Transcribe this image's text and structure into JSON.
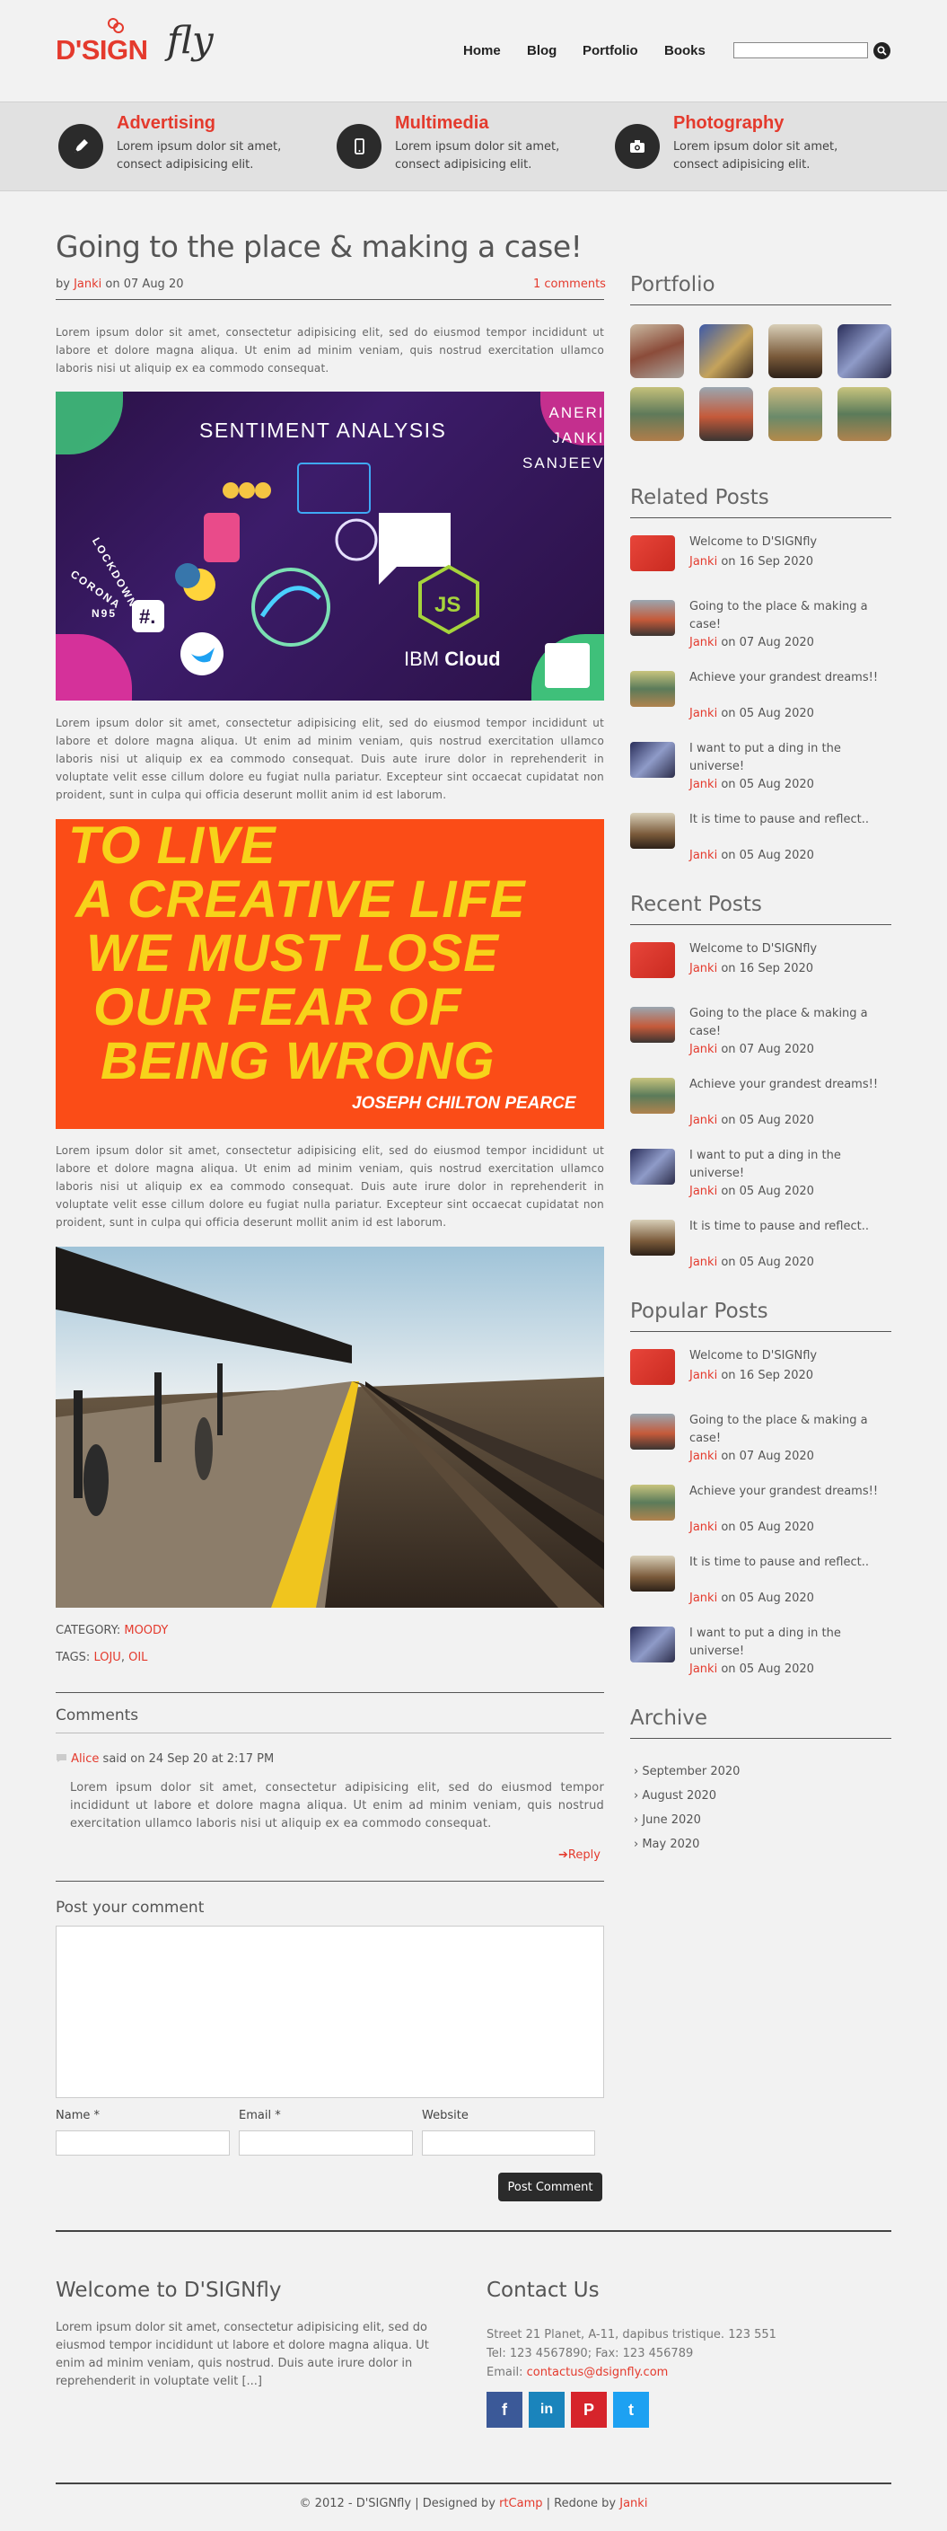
{
  "header": {
    "logo_text_main": "D'SIGN",
    "logo_text_script": "fly",
    "nav": [
      "Home",
      "Blog",
      "Portfolio",
      "Books"
    ],
    "search_placeholder": ""
  },
  "features": [
    {
      "icon": "pen-icon",
      "title": "Advertising",
      "text": "Lorem ipsum dolor sit amet, consect adipisicing elit."
    },
    {
      "icon": "phone-icon",
      "title": "Multimedia",
      "text": "Lorem ipsum dolor sit amet, consect adipisicing elit."
    },
    {
      "icon": "camera-icon",
      "title": "Photography",
      "text": "Lorem ipsum dolor sit amet, consect adipisicing elit."
    }
  ],
  "post": {
    "title": "Going to the place & making a case!",
    "by": "by",
    "author": "Janki",
    "on": "on 07 Aug 20",
    "comments_link": "1 comments",
    "para1": "Lorem ipsum dolor sit amet, consectetur adipisicing elit, sed do eiusmod tempor incididunt ut labore et dolore magna aliqua. Ut enim ad minim veniam, quis nostrud exercitation ullamco laboris nisi ut aliquip ex ea commodo consequat.",
    "para2": "Lorem ipsum dolor sit amet, consectetur adipisicing elit, sed do eiusmod tempor incididunt ut labore et dolore magna aliqua. Ut enim ad minim veniam, quis nostrud exercitation ullamco laboris nisi ut aliquip ex ea commodo consequat. Duis aute irure dolor in reprehenderit in voluptate velit esse cillum dolore eu fugiat nulla pariatur. Excepteur sint occaecat cupidatat non proident, sunt in culpa qui officia deserunt mollit anim id est laborum.",
    "para3": "Lorem ipsum dolor sit amet, consectetur adipisicing elit, sed do eiusmod tempor incididunt ut labore et dolore magna aliqua. Ut enim ad minim veniam, quis nostrud exercitation ullamco laboris nisi ut aliquip ex ea commodo consequat. Duis aute irure dolor in reprehenderit in voluptate velit esse cillum dolore eu fugiat nulla pariatur. Excepteur sint occaecat cupidatat non proident, sunt in culpa qui officia deserunt mollit anim id est laborum.",
    "img1": {
      "title": "SENTIMENT ANALYSIS",
      "names": [
        "ANERI",
        "JANKI",
        "SANJEEV"
      ],
      "side_words": [
        "LOCKDOWN",
        "CORONA",
        "N95"
      ],
      "ibm": "IBM",
      "cloud": "Cloud"
    },
    "img2": {
      "lines": [
        "TO LIVE",
        "A CREATIVE LIFE",
        "WE MUST LOSE",
        "OUR FEAR OF",
        "BEING WRONG"
      ],
      "author": "JOSEPH CHILTON PEARCE"
    },
    "category_label": "CATEGORY:",
    "category": "MOODY",
    "tags_label": "TAGS:",
    "tags": [
      "LOJU",
      "OIL"
    ]
  },
  "comments": {
    "heading": "Comments",
    "items": [
      {
        "author": "Alice",
        "said": "said on 24 Sep 20 at 2:17 PM",
        "text": "Lorem ipsum dolor sit amet, consectetur adipisicing elit, sed do eiusmod tempor incididunt ut labore et dolore magna aliqua. Ut enim ad minim veniam, quis nostrud exercitation ullamco laboris nisi ut aliquip ex ea commodo consequat.",
        "reply": "Reply"
      }
    ],
    "post_heading": "Post your comment",
    "name_label": "Name *",
    "email_label": "Email *",
    "website_label": "Website",
    "submit": "Post Comment"
  },
  "sidebar": {
    "portfolio_heading": "Portfolio",
    "related_heading": "Related Posts",
    "recent_heading": "Recent Posts",
    "popular_heading": "Popular Posts",
    "archive_heading": "Archive",
    "related": [
      {
        "title": "Welcome to D'SIGNfly",
        "author": "Janki",
        "date": "on 16 Sep 2020",
        "thumb": "red"
      },
      {
        "title": "Going to the place & making a case!",
        "author": "Janki",
        "date": "on 07 Aug 2020",
        "thumb": "city"
      },
      {
        "title": "Achieve your grandest dreams!!",
        "author": "Janki",
        "date": "on 05 Aug 2020",
        "thumb": "green"
      },
      {
        "title": "I want to put a ding in the universe!",
        "author": "Janki",
        "date": "on 05 Aug 2020",
        "thumb": "blue"
      },
      {
        "title": "It is time to pause and reflect..",
        "author": "Janki",
        "date": "on 05 Aug 2020",
        "thumb": "warm"
      }
    ],
    "recent": [
      {
        "title": "Welcome to D'SIGNfly",
        "author": "Janki",
        "date": "on 16 Sep 2020",
        "thumb": "red"
      },
      {
        "title": "Going to the place & making a case!",
        "author": "Janki",
        "date": "on 07 Aug 2020",
        "thumb": "city"
      },
      {
        "title": "Achieve your grandest dreams!!",
        "author": "Janki",
        "date": "on 05 Aug 2020",
        "thumb": "green"
      },
      {
        "title": "I want to put a ding in the universe!",
        "author": "Janki",
        "date": "on 05 Aug 2020",
        "thumb": "blue"
      },
      {
        "title": "It is time to pause and reflect..",
        "author": "Janki",
        "date": "on 05 Aug 2020",
        "thumb": "warm"
      }
    ],
    "popular": [
      {
        "title": "Welcome to D'SIGNfly",
        "author": "Janki",
        "date": "on 16 Sep 2020",
        "thumb": "red"
      },
      {
        "title": "Going to the place & making a case!",
        "author": "Janki",
        "date": "on 07 Aug 2020",
        "thumb": "city"
      },
      {
        "title": "Achieve your grandest dreams!!",
        "author": "Janki",
        "date": "on 05 Aug 2020",
        "thumb": "green"
      },
      {
        "title": "It is time to pause and reflect..",
        "author": "Janki",
        "date": "on 05 Aug 2020",
        "thumb": "warm"
      },
      {
        "title": "I want to put a ding in the universe!",
        "author": "Janki",
        "date": "on 05 Aug 2020",
        "thumb": "blue"
      }
    ],
    "archive": [
      "September 2020",
      "August 2020",
      "June 2020",
      "May 2020"
    ]
  },
  "footer": {
    "welcome_heading": "Welcome to D'SIGNfly",
    "welcome_text": "Lorem ipsum dolor sit amet, consectetur adipisicing elit, sed do eiusmod tempor incididunt ut labore et dolore magna aliqua. Ut enim ad minim veniam, quis nostrud. Duis aute irure dolor in reprehenderit in voluptate velit [...]",
    "contact_heading": "Contact Us",
    "address": "Street 21 Planet, A-11, dapibus tristique. 123 551",
    "tel": "Tel: 123 4567890; Fax: 123 456789",
    "email_label": "Email:",
    "email": "contactus@dsignfly.com",
    "social": [
      "f",
      "in",
      "P",
      "t"
    ],
    "copyright": "© 2012 - D'SIGNfly | Designed by",
    "rtcamp": "rtCamp",
    "redone": "| Redone by",
    "redone_by": "Janki"
  },
  "colors": {
    "accent": "#e43a2d",
    "dark": "#2b2b2b",
    "band": "#e1e1e1",
    "facebook": "#3b5998",
    "linkedin": "#1a84bc",
    "pinterest": "#d6242b",
    "twitter": "#1da1f2"
  }
}
